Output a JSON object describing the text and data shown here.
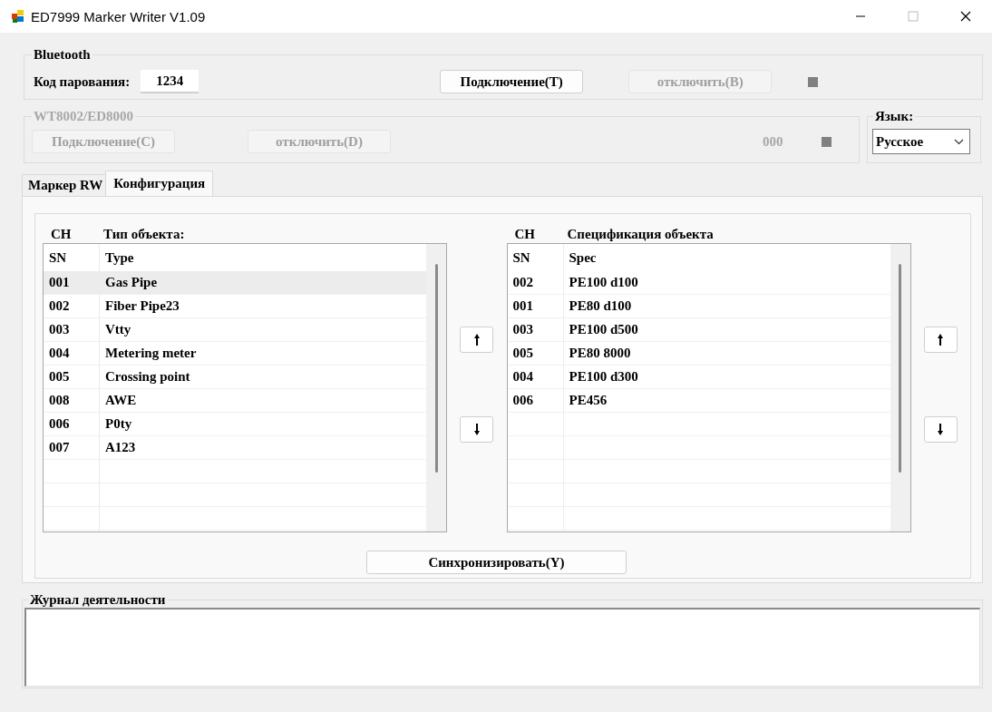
{
  "window": {
    "title": "ED7999 Marker Writer V1.09"
  },
  "bluetooth": {
    "title": "Bluetooth",
    "pairing_label": "Код парования:",
    "pairing_code": "1234",
    "buttons": [
      {
        "label": "Подключение(T)",
        "disabled": false
      },
      {
        "label": "отключить(B)",
        "disabled": true
      }
    ]
  },
  "wt": {
    "title": "WT8002/ED8000",
    "disabled": true,
    "buttons": [
      {
        "label": "Подключение(C)",
        "disabled": true
      },
      {
        "label": "отключить(D)",
        "disabled": true
      }
    ],
    "reading": "000"
  },
  "language": {
    "title": "Язык:",
    "value": "Русское"
  },
  "tabs": [
    {
      "label": "Маркер RW",
      "selected": false
    },
    {
      "label": "Конфигурация",
      "selected": true
    }
  ],
  "lists": [
    {
      "ch_label": "CH",
      "title": "Тип объекта:",
      "columns": [
        "SN",
        "Type"
      ],
      "rows": [
        {
          "sn": "001",
          "value": "Gas Pipe",
          "selected": true
        },
        {
          "sn": "002",
          "value": "Fiber Pipe23",
          "selected": false
        },
        {
          "sn": "003",
          "value": "Vtty",
          "selected": false
        },
        {
          "sn": "004",
          "value": "Metering meter",
          "selected": false
        },
        {
          "sn": "005",
          "value": "Crossing point",
          "selected": false
        },
        {
          "sn": "008",
          "value": "AWE",
          "selected": false
        },
        {
          "sn": "006",
          "value": "P0ty",
          "selected": false
        },
        {
          "sn": "007",
          "value": "A123",
          "selected": false
        }
      ]
    },
    {
      "ch_label": "CH",
      "title": "Спецификация объекта",
      "columns": [
        "SN",
        "Spec"
      ],
      "rows": [
        {
          "sn": "002",
          "value": "PE100 d100",
          "selected": false
        },
        {
          "sn": "001",
          "value": "PE80 d100",
          "selected": false
        },
        {
          "sn": "003",
          "value": "PE100 d500",
          "selected": false
        },
        {
          "sn": "005",
          "value": "PE80 8000",
          "selected": false
        },
        {
          "sn": "004",
          "value": "PE100 d300",
          "selected": false
        },
        {
          "sn": "006",
          "value": "PE456",
          "selected": false
        }
      ]
    }
  ],
  "sync_button": "Синхронизировать(Y)",
  "log": {
    "title": "Журнал деятельности"
  }
}
